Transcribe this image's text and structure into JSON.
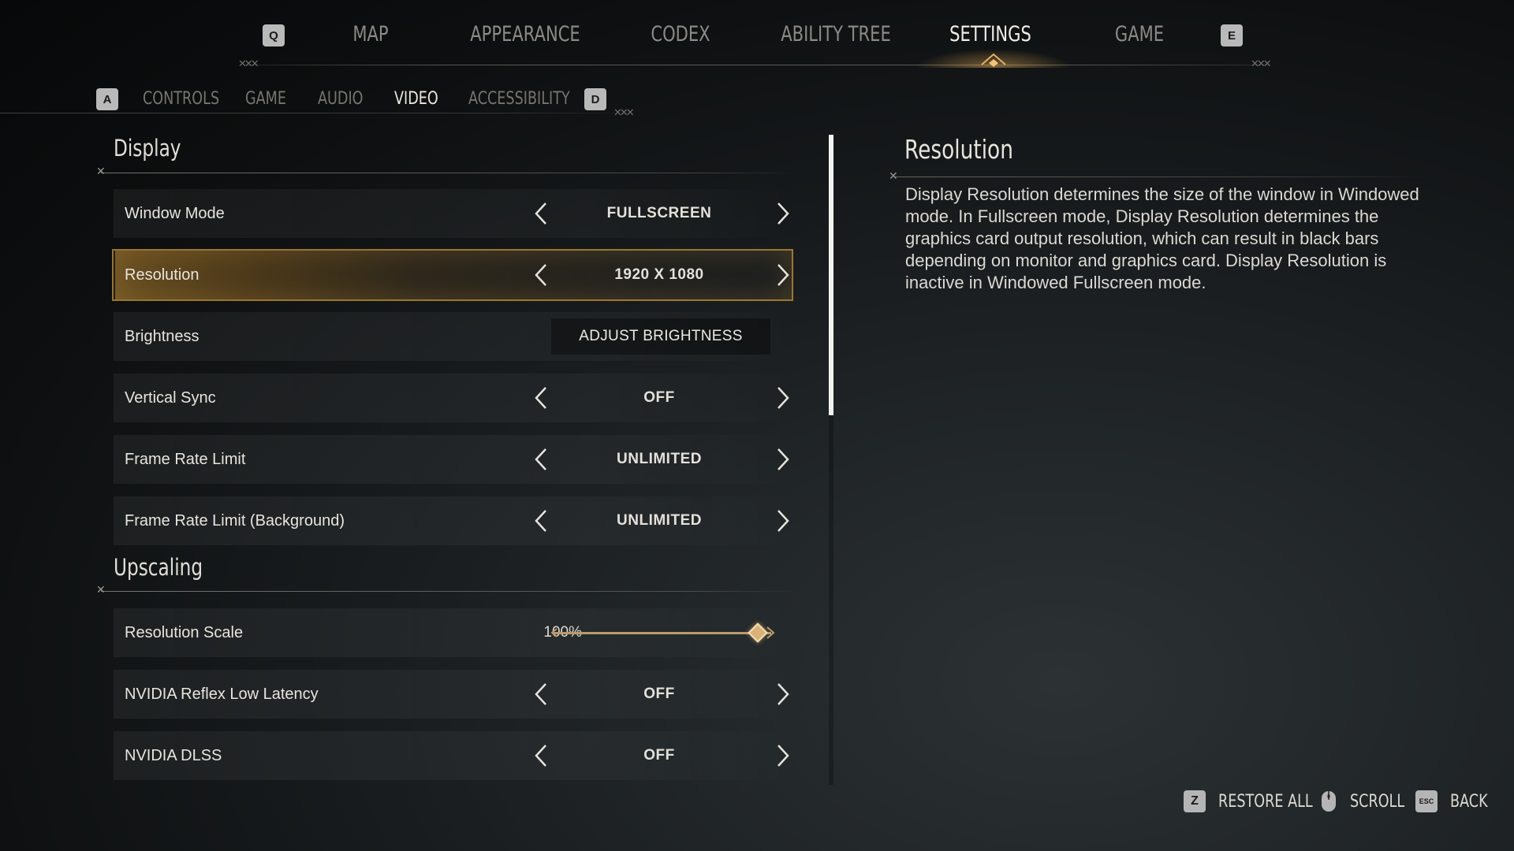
{
  "top_nav": {
    "left_key": "Q",
    "right_key": "E",
    "tabs": [
      {
        "label": "MAP"
      },
      {
        "label": "APPEARANCE"
      },
      {
        "label": "CODEX"
      },
      {
        "label": "ABILITY TREE"
      },
      {
        "label": "SETTINGS",
        "active": true
      },
      {
        "label": "GAME"
      }
    ]
  },
  "sub_nav": {
    "left_key": "A",
    "right_key": "D",
    "tabs": [
      {
        "label": "CONTROLS"
      },
      {
        "label": "GAME"
      },
      {
        "label": "AUDIO"
      },
      {
        "label": "VIDEO",
        "active": true
      },
      {
        "label": "ACCESSIBILITY"
      }
    ]
  },
  "sections": {
    "display": {
      "title": "Display",
      "rows": [
        {
          "label": "Window Mode",
          "value": "FULLSCREEN"
        },
        {
          "label": "Resolution",
          "value": "1920 X 1080",
          "selected": true
        },
        {
          "label": "Brightness",
          "button": "ADJUST BRIGHTNESS"
        },
        {
          "label": "Vertical Sync",
          "value": "OFF"
        },
        {
          "label": "Frame Rate Limit",
          "value": "UNLIMITED"
        },
        {
          "label": "Frame Rate Limit (Background)",
          "value": "UNLIMITED"
        }
      ]
    },
    "upscaling": {
      "title": "Upscaling",
      "rows": [
        {
          "label": "Resolution Scale",
          "value_text": "100%",
          "slider_fraction": 1.0
        },
        {
          "label": "NVIDIA Reflex Low Latency",
          "value": "OFF"
        },
        {
          "label": "NVIDIA DLSS",
          "value": "OFF"
        }
      ]
    }
  },
  "description": {
    "title": "Resolution",
    "body": "Display Resolution determines the size of the window in Windowed mode. In Fullscreen mode, Display Resolution determines the graphics card output resolution, which can result in black bars depending on monitor and graphics card. Display Resolution is inactive in Windowed Fullscreen mode."
  },
  "footer": {
    "restore": {
      "key": "Z",
      "label": "RESTORE ALL"
    },
    "scroll": {
      "icon": "mouse-icon",
      "label": "SCROLL"
    },
    "back": {
      "key": "ESC",
      "label": "BACK"
    }
  },
  "colors": {
    "accent_gold": "#c8963c",
    "active_tab": "#f2eee6",
    "inactive_tab": "#8c8a86"
  }
}
